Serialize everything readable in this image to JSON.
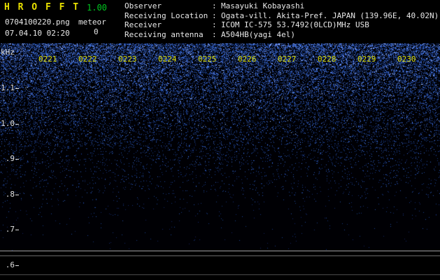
{
  "colors": {
    "title": "#e8e000",
    "version": "#00c820",
    "time_labels": "#d8d800",
    "axis_labels": "#e0e0e0",
    "noise_blue": "#2030c0",
    "background": "#000000"
  },
  "app": {
    "title": "H R O F F T",
    "version": "1.00",
    "filename": "0704100220.png",
    "meteor_label": "meteor",
    "meteor_count": "0",
    "timestamp": "07.04.10 02:20"
  },
  "station": {
    "separator": ":",
    "rows": [
      {
        "label": "Observer",
        "value": "Masayuki Kobayashi"
      },
      {
        "label": "Receiving Location",
        "value": "Ogata-vill. Akita-Pref. JAPAN (139.96E, 40.02N)"
      },
      {
        "label": "Receiver",
        "value": "ICOM IC-575 53.7492(0LCD)MHz USB"
      },
      {
        "label": "Receiving antenna",
        "value": "A504HB(yagi 4el)"
      }
    ]
  },
  "spectrogram": {
    "freq_unit": "kHz",
    "freq_ticks": [
      "1.1",
      "1.0",
      ".9",
      ".8",
      ".7",
      ".6"
    ],
    "time_ticks": [
      "0221",
      "0222",
      "0223",
      "0224",
      "0225",
      "0226",
      "0227",
      "0228",
      "0229",
      "0230"
    ]
  }
}
